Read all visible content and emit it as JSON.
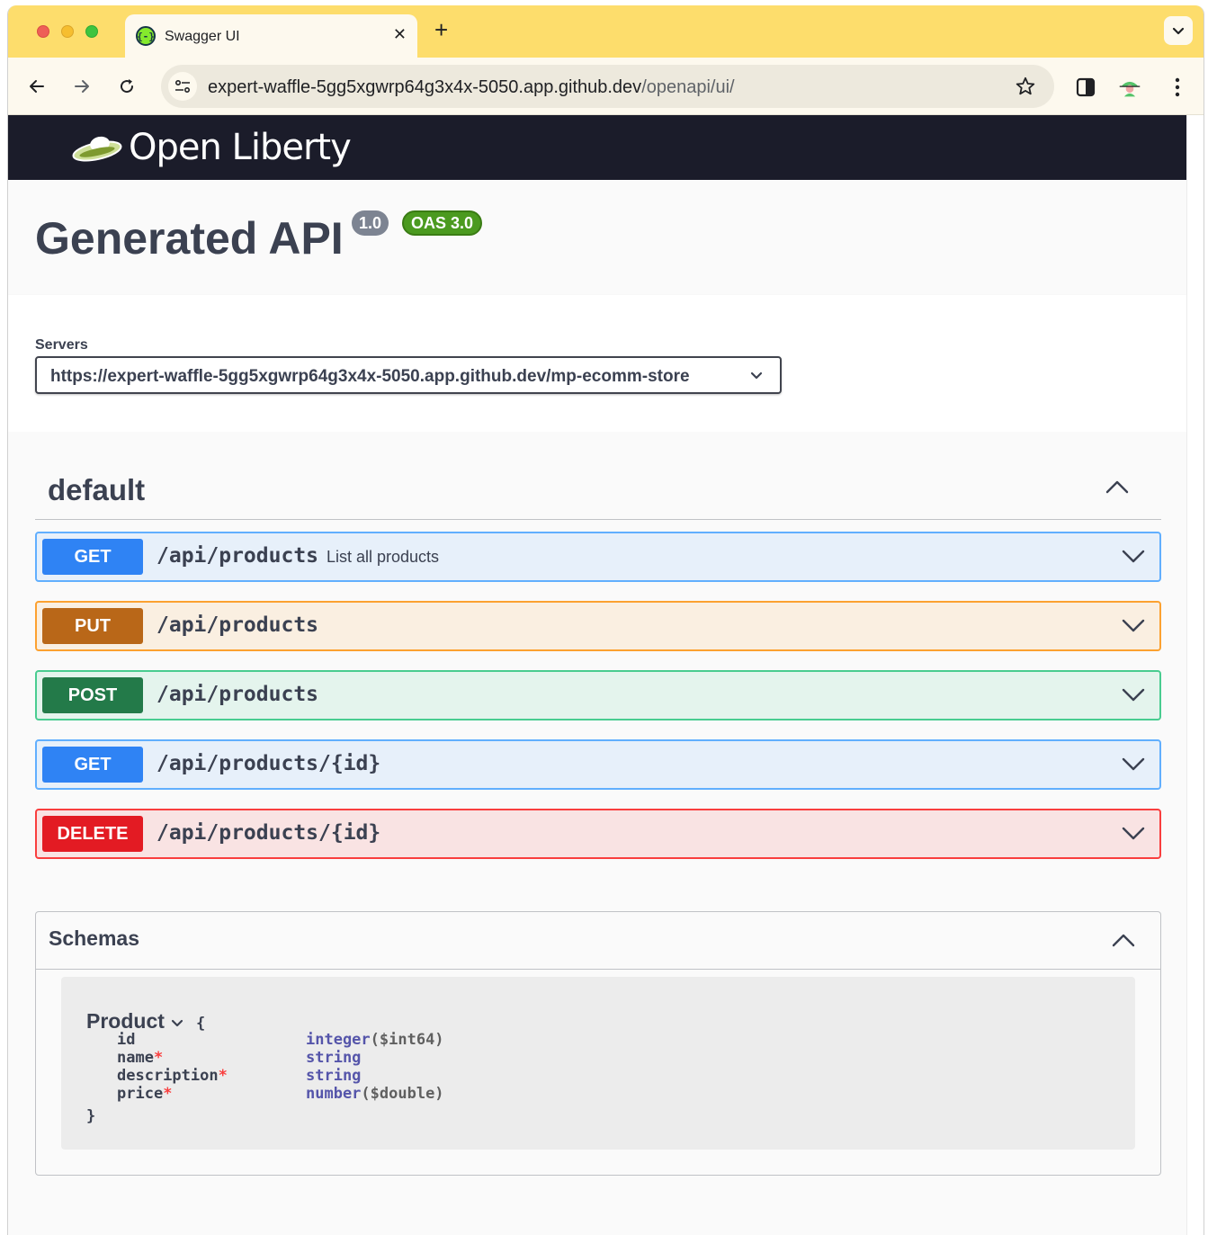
{
  "browser": {
    "tab_title": "Swagger UI",
    "tab_favicon": "{-}",
    "url_host": "expert-waffle-5gg5xgwrp64g3x4x-5050.app.github.dev",
    "url_path": "/openapi/ui/",
    "colors": {
      "tabstrip": "#fddd6c",
      "toolbar": "#fdf9ee"
    }
  },
  "brand": {
    "logo_text": "Open Liberty",
    "topbar_color": "#1b1c2a"
  },
  "info": {
    "title": "Generated API",
    "version": "1.0",
    "oas": "OAS 3.0"
  },
  "servers": {
    "label": "Servers",
    "selected": "https://expert-waffle-5gg5xgwrp64g3x4x-5050.app.github.dev/mp-ecomm-store"
  },
  "tag": {
    "name": "default"
  },
  "operations": [
    {
      "method": "GET",
      "path": "/api/products",
      "summary": "List all products",
      "color": "#61affe"
    },
    {
      "method": "PUT",
      "path": "/api/products",
      "summary": "",
      "color": "#fca130"
    },
    {
      "method": "POST",
      "path": "/api/products",
      "summary": "",
      "color": "#49cc90"
    },
    {
      "method": "GET",
      "path": "/api/products/{id}",
      "summary": "",
      "color": "#61affe"
    },
    {
      "method": "DELETE",
      "path": "/api/products/{id}",
      "summary": "",
      "color": "#f93e3e"
    }
  ],
  "schemas": {
    "title": "Schemas",
    "model": {
      "name": "Product",
      "open_brace": "{",
      "close_brace": "}",
      "required_marker": "*",
      "properties": [
        {
          "name": "id",
          "required": false,
          "type": "integer",
          "format": "($int64)"
        },
        {
          "name": "name",
          "required": true,
          "type": "string",
          "format": ""
        },
        {
          "name": "description",
          "required": true,
          "type": "string",
          "format": ""
        },
        {
          "name": "price",
          "required": true,
          "type": "number",
          "format": "($double)"
        }
      ]
    }
  }
}
